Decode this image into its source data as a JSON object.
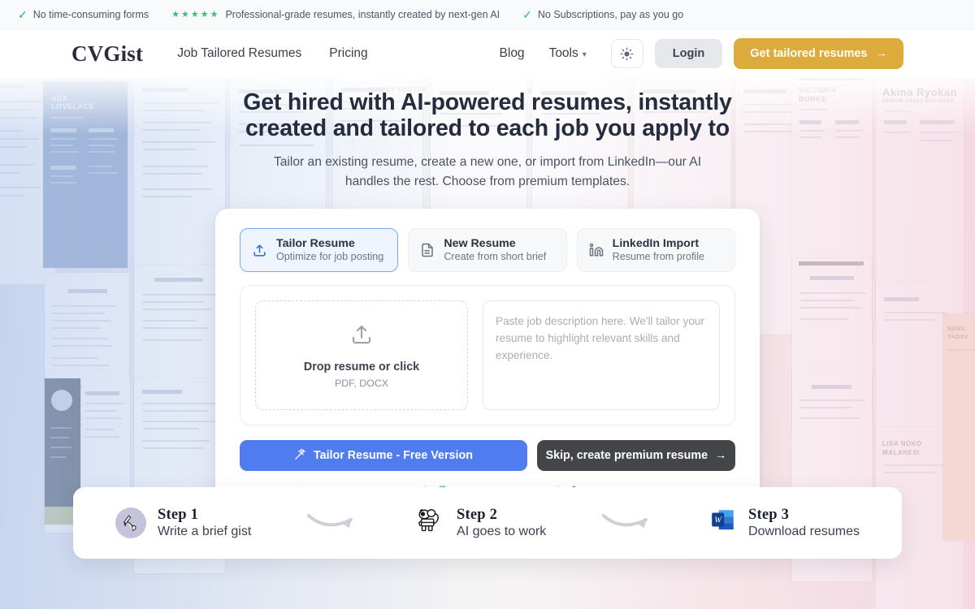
{
  "announcement": {
    "items": [
      {
        "icon": "check-icon",
        "text": "No time-consuming forms"
      },
      {
        "icon": "stars-icon",
        "stars": "★★★★★",
        "text": "Professional-grade resumes, instantly created by next-gen AI"
      },
      {
        "icon": "check-icon",
        "text": "No Subscriptions, pay as you go"
      }
    ]
  },
  "header": {
    "brand": "CVGist",
    "nav_left": [
      {
        "label": "Job Tailored Resumes"
      },
      {
        "label": "Pricing"
      }
    ],
    "nav_right": [
      {
        "label": "Blog"
      }
    ],
    "tools": {
      "label": "Tools",
      "chevron": "chevron-down-icon"
    },
    "theme_toggle": "sun-icon",
    "login_label": "Login",
    "cta_label": "Get tailored resumes",
    "cta_arrow": "→"
  },
  "hero": {
    "headline_line1": "Get hired with AI-powered resumes, instantly",
    "headline_line2": "created and tailored to each job you apply to",
    "subhead": "Tailor an existing resume, create a new one, or import from LinkedIn—our AI handles the rest. Choose from premium templates."
  },
  "card": {
    "tabs": [
      {
        "icon": "upload-icon",
        "title": "Tailor Resume",
        "subtitle": "Optimize for job posting",
        "active": true
      },
      {
        "icon": "document-icon",
        "title": "New Resume",
        "subtitle": "Create from short brief",
        "active": false
      },
      {
        "icon": "linkedin-icon",
        "title": "LinkedIn Import",
        "subtitle": "Resume from profile",
        "active": false
      }
    ],
    "dropzone": {
      "icon": "upload-icon",
      "title": "Drop resume or click",
      "formats": "PDF, DOCX"
    },
    "job_description": {
      "value": "",
      "placeholder": "Paste job description here. We'll tailor your resume to highlight relevant skills and experience."
    },
    "primary_button": {
      "icon": "magic-wand-icon",
      "label": "Tailor Resume - Free Version"
    },
    "secondary_button": {
      "label": "Skip, create premium resume",
      "arrow": "→"
    },
    "features": [
      {
        "icon": "sparkles-icon",
        "label": "AI-Enhanced Content",
        "color": "#e0b33f"
      },
      {
        "icon": "document-icon",
        "label": "Premium Templates",
        "color": "#4caf7d"
      },
      {
        "icon": "linkedin-icon",
        "label": "LinkedIn Integration",
        "color": "#3b82d6"
      }
    ]
  },
  "steps": {
    "arrow": "curved-arrow-icon",
    "items": [
      {
        "icon": "writing-hand-icon",
        "title": "Step 1",
        "subtitle": "Write a brief gist"
      },
      {
        "icon": "robot-icon",
        "title": "Step 2",
        "subtitle": "AI goes to work"
      },
      {
        "icon": "word-document-icon",
        "title": "Step 3",
        "subtitle": "Download resumes"
      }
    ]
  },
  "colors": {
    "brand_gold": "#ddab3c",
    "primary_blue": "#4f7df0",
    "dark_button": "#434549",
    "green_accent": "#2bb673",
    "active_tab_border": "#7aa7f0"
  }
}
